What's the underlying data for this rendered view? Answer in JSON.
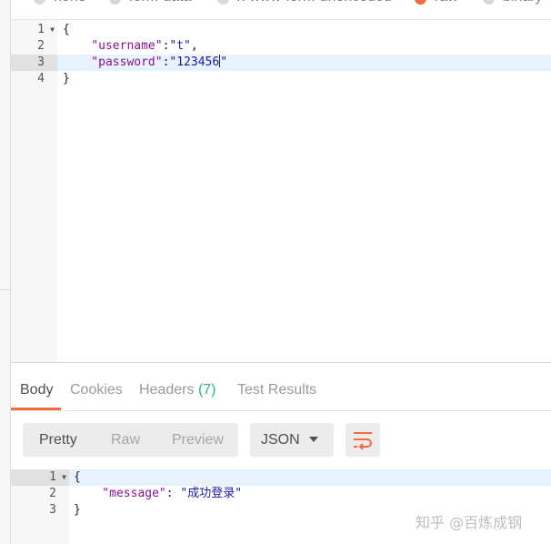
{
  "body_types": [
    {
      "label": "none",
      "selected": false
    },
    {
      "label": "form-data",
      "selected": false
    },
    {
      "label": "x-www-form-urlencoded",
      "selected": false
    },
    {
      "label": "raw",
      "selected": true
    },
    {
      "label": "binary",
      "selected": false
    }
  ],
  "request_editor": {
    "lines": [
      {
        "num": "1",
        "fold": true,
        "parts": [
          {
            "t": "{",
            "c": "p"
          }
        ]
      },
      {
        "num": "2",
        "fold": false,
        "parts": [
          {
            "t": "    \"username\"",
            "c": "key"
          },
          {
            "t": ":",
            "c": "p"
          },
          {
            "t": "\"t\"",
            "c": "str"
          },
          {
            "t": ",",
            "c": "p"
          }
        ]
      },
      {
        "num": "3",
        "fold": false,
        "active": true,
        "parts": [
          {
            "t": "    \"password\"",
            "c": "key"
          },
          {
            "t": ":",
            "c": "p"
          },
          {
            "t": "\"123456",
            "c": "str"
          },
          {
            "t": "\"",
            "c": "str"
          }
        ]
      },
      {
        "num": "4",
        "fold": false,
        "parts": [
          {
            "t": "}",
            "c": "p"
          }
        ]
      }
    ]
  },
  "response_tabs": {
    "body": "Body",
    "cookies": "Cookies",
    "headers": "Headers",
    "headers_count": "(7)",
    "test_results": "Test Results"
  },
  "view_modes": {
    "pretty": "Pretty",
    "raw": "Raw",
    "preview": "Preview"
  },
  "format_select": {
    "value": "JSON"
  },
  "response_editor": {
    "lines": [
      {
        "num": "1",
        "fold": true,
        "active": true,
        "parts": [
          {
            "t": "{",
            "c": "p"
          }
        ]
      },
      {
        "num": "2",
        "fold": false,
        "parts": [
          {
            "t": "    \"message\"",
            "c": "key"
          },
          {
            "t": ": ",
            "c": "p"
          },
          {
            "t": "\"成功登录\"",
            "c": "str"
          }
        ]
      },
      {
        "num": "3",
        "fold": false,
        "parts": [
          {
            "t": "}",
            "c": "p"
          }
        ]
      }
    ]
  },
  "watermark": "知乎 @百炼成钢",
  "colors": {
    "accent": "#f26b3a",
    "headers_count": "#26b47f",
    "json_key": "#881391",
    "json_string": "#1a1aa6"
  }
}
